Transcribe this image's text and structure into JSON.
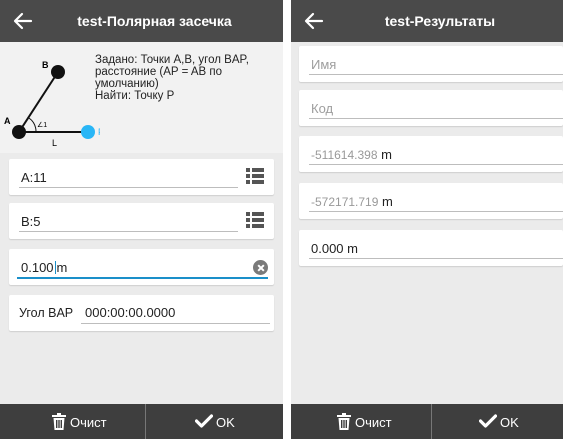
{
  "left": {
    "title": "test-Полярная засечка",
    "diagram": {
      "label_a": "A",
      "label_b": "B",
      "label_l": "L",
      "label_p": "P",
      "label_angle": "∠1",
      "description": "Задано: Точки A,B, угол BAP, расстояние (AP = AB по умолчанию)\nНайти: Точку P"
    },
    "fields": {
      "point_a": "A:11",
      "point_b": "B:5",
      "distance_value": "0.100",
      "distance_unit": "m",
      "angle_label": "Угол BAP",
      "angle_value": "000:00:00.0000"
    },
    "bottom": {
      "clear_label": "Очист",
      "ok_label": "OK"
    }
  },
  "right": {
    "title": "test-Результаты",
    "fields": {
      "name_placeholder": "Имя",
      "code_placeholder": "Код",
      "x_value": "-511614.398",
      "y_value": "-572171.719",
      "coord_unit": "m",
      "height_value": "0.000 m"
    },
    "bottom": {
      "clear_label": "Очист",
      "ok_label": "OK"
    }
  },
  "colors": {
    "appbar": "#4a4a4a",
    "bottombar": "#3e3e3e",
    "accent": "#1a8fc9",
    "point_p": "#29b6f6"
  },
  "icons": [
    "back-arrow-icon",
    "list-icon",
    "clear-icon",
    "trash-icon",
    "checkmark-icon"
  ]
}
